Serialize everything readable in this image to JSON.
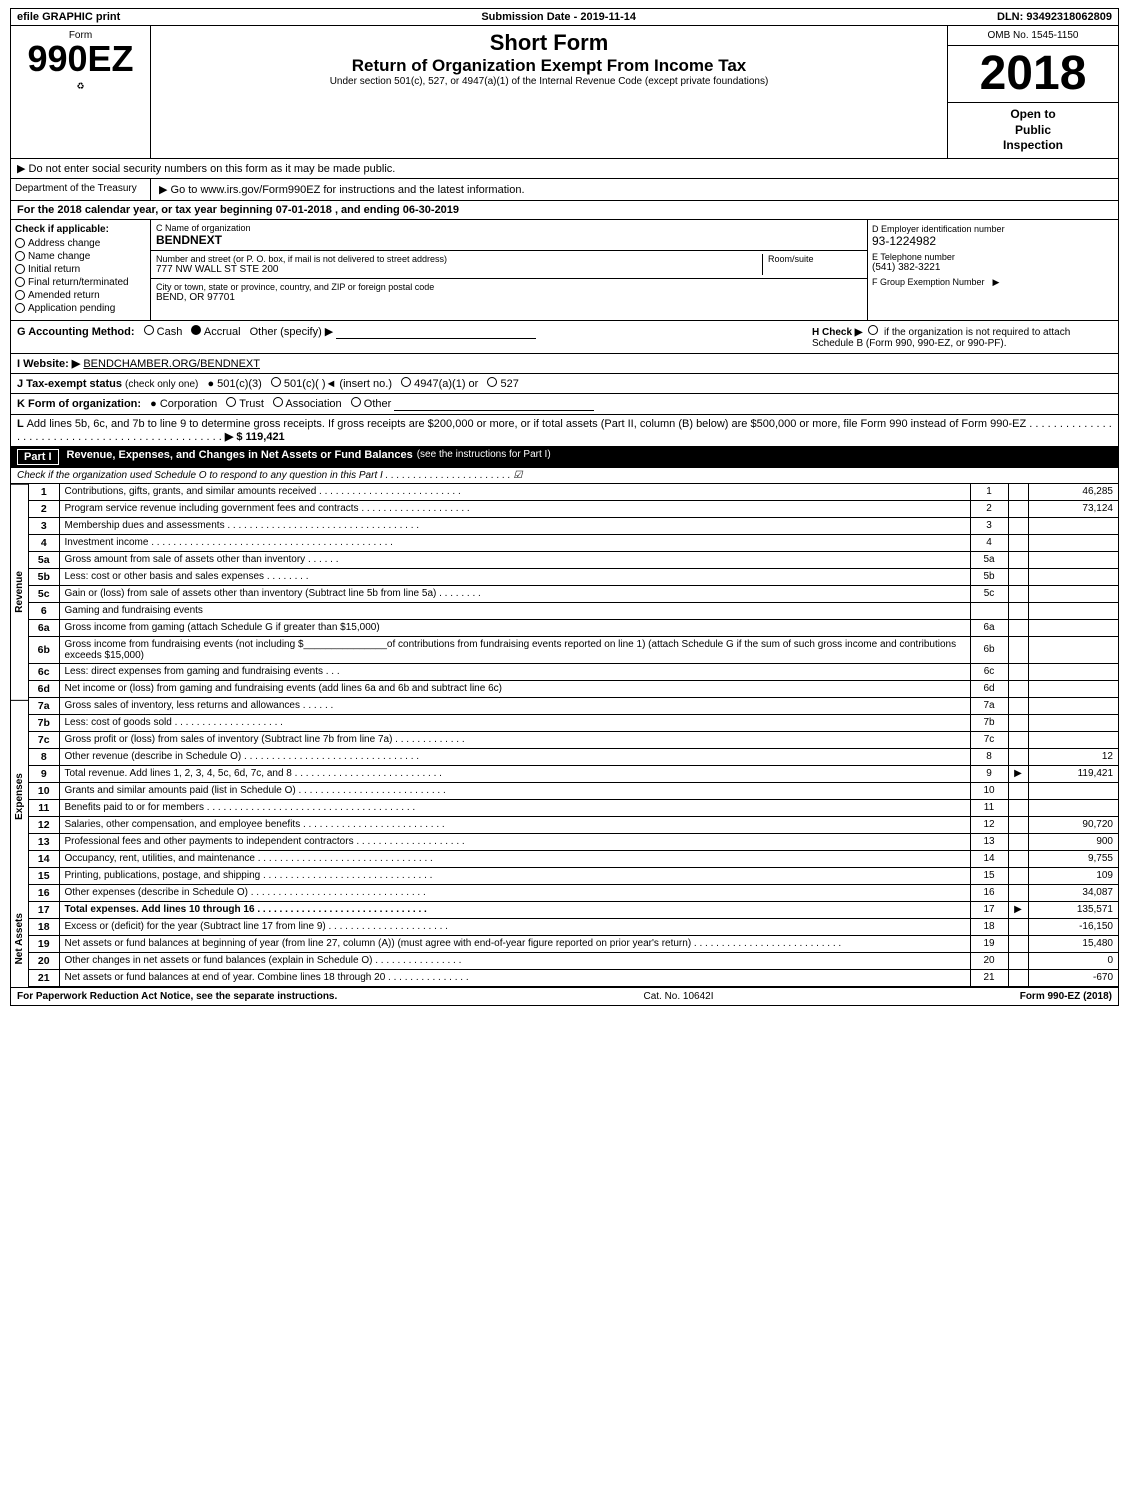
{
  "header": {
    "efile_label": "efile GRAPHIC print",
    "submission_label": "Submission Date - 2019-11-14",
    "dln_label": "DLN: 93492318062809"
  },
  "form_info": {
    "form_number": "990EZ",
    "form_label": "Form",
    "short_form": "Short Form",
    "return_title": "Return of Organization Exempt From Income Tax",
    "under_section": "Under section 501(c), 527, or 4947(a)(1) of the Internal Revenue Code (except private foundations)",
    "omb": "OMB No. 1545-1150",
    "year": "2018",
    "open_to_public": "Open to\nPublic\nInspection"
  },
  "notices": {
    "ssn_notice": "▶ Do not enter social security numbers on this form as it may be made public.",
    "irs_notice": "▶ Go to www.irs.gov/Form990EZ for instructions and the latest information."
  },
  "dept": {
    "name": "Department of the Treasury"
  },
  "tax_year": {
    "text": "For the 2018 calendar year, or tax year beginning 07-01-2018",
    "ending": ", and ending 06-30-2019"
  },
  "check_if": {
    "label": "Check if applicable:",
    "items": [
      {
        "label": "Address change",
        "checked": false
      },
      {
        "label": "Name change",
        "checked": false
      },
      {
        "label": "Initial return",
        "checked": false
      },
      {
        "label": "Final return/terminated",
        "checked": false
      },
      {
        "label": "Amended return",
        "checked": false
      },
      {
        "label": "Application pending",
        "checked": false
      }
    ]
  },
  "org": {
    "c_label": "C Name of organization",
    "name": "BENDNEXT",
    "street_label": "Number and street (or P. O. box, if mail is not delivered to street address)",
    "street": "777 NW WALL ST STE 200",
    "room_label": "Room/suite",
    "room": "",
    "city_label": "City or town, state or province, country, and ZIP or foreign postal code",
    "city": "BEND, OR  97701",
    "d_label": "D Employer identification number",
    "ein": "93-1224982",
    "e_label": "E Telephone number",
    "phone": "(541) 382-3221",
    "f_label": "F Group Exemption Number",
    "group_num": ""
  },
  "accounting": {
    "g_label": "G Accounting Method:",
    "cash": "Cash",
    "accrual": "Accrual",
    "accrual_checked": true,
    "other": "Other (specify) ▶",
    "h_label": "H  Check ▶",
    "h_text": "if the organization is not required to attach Schedule B (Form 990, 990-EZ, or 990-PF)."
  },
  "website": {
    "i_label": "I Website: ▶",
    "url": "BENDCHAMBER.ORG/BENDNEXT"
  },
  "tax_exempt": {
    "j_label": "J Tax-exempt status",
    "j_note": "(check only one)",
    "options": [
      "501(c)(3)",
      "501(c)(  )◄ (insert no.)",
      "4947(a)(1) or",
      "527"
    ],
    "checked": "501(c)(3)"
  },
  "form_org": {
    "k_label": "K Form of organization:",
    "options": [
      "Corporation",
      "Trust",
      "Association",
      "Other"
    ],
    "checked": "Corporation"
  },
  "l_section": {
    "text": "L Add lines 5b, 6c, and 7b to line 9 to determine gross receipts. If gross receipts are $200,000 or more, or if total assets (Part II, column (B) below) are $500,000 or more, file Form 990 instead of Form 990-EZ . . . . . . . . . . . . . . . . . . . . . . . . . . . . . . . . . . .",
    "amount": "▶ $ 119,421"
  },
  "part1": {
    "label": "Part I",
    "title": "Revenue, Expenses, and Changes in Net Assets or Fund Balances",
    "see_instructions": "(see the instructions for Part I)",
    "schedule_check": "Check if the organization used Schedule O to respond to any question in this Part I . . . . . . . . . . . . . . . . . . . . . . .",
    "schedule_check_box": "☑"
  },
  "revenue_label": "Revenue",
  "expenses_label": "Expenses",
  "net_assets_label": "Net Assets",
  "lines": [
    {
      "num": "1",
      "desc": "Contributions, gifts, grants, and similar amounts received . . . . . . . . . . . . . . . . . . . . . . . . . .",
      "box": "1",
      "val": "46,285"
    },
    {
      "num": "2",
      "desc": "Program service revenue including government fees and contracts . . . . . . . . . . . . . . . . . . . .",
      "box": "2",
      "val": "73,124"
    },
    {
      "num": "3",
      "desc": "Membership dues and assessments . . . . . . . . . . . . . . . . . . . . . . . . . . . . . . . . . . .",
      "box": "3",
      "val": ""
    },
    {
      "num": "4",
      "desc": "Investment income . . . . . . . . . . . . . . . . . . . . . . . . . . . . . . . . . . . . . . . . . . . .",
      "box": "4",
      "val": ""
    },
    {
      "num": "5a",
      "desc": "Gross amount from sale of assets other than inventory . . . . . .",
      "box": "5a",
      "val": ""
    },
    {
      "num": "5b",
      "desc": "Less: cost or other basis and sales expenses . . . . . . . .",
      "box": "5b",
      "val": ""
    },
    {
      "num": "5c",
      "desc": "Gain or (loss) from sale of assets other than inventory (Subtract line 5b from line 5a) . . . . . . . .",
      "box": "5c",
      "val": ""
    },
    {
      "num": "6",
      "desc": "Gaming and fundraising events",
      "box": "",
      "val": ""
    },
    {
      "num": "6a",
      "desc": "Gross income from gaming (attach Schedule G if greater than $15,000)",
      "box": "6a",
      "val": ""
    },
    {
      "num": "6b",
      "desc": "Gross income from fundraising events (not including $_______________of contributions from fundraising events reported on line 1) (attach Schedule G if the sum of such gross income and contributions exceeds $15,000)",
      "box": "6b",
      "val": ""
    },
    {
      "num": "6c",
      "desc": "Less: direct expenses from gaming and fundraising events  .  .  .",
      "box": "6c",
      "val": ""
    },
    {
      "num": "6d",
      "desc": "Net income or (loss) from gaming and fundraising events (add lines 6a and 6b and subtract line 6c)",
      "box": "6d",
      "val": ""
    },
    {
      "num": "7a",
      "desc": "Gross sales of inventory, less returns and allowances . . . . . .",
      "box": "7a",
      "val": ""
    },
    {
      "num": "7b",
      "desc": "Less: cost of goods sold   .  .  .  .  .  .  .  .  .  .  .  .  .  .  .  .  .  .  .  .",
      "box": "7b",
      "val": ""
    },
    {
      "num": "7c",
      "desc": "Gross profit or (loss) from sales of inventory (Subtract line 7b from line 7a) . . . . . . . . . . . . .",
      "box": "7c",
      "val": ""
    },
    {
      "num": "8",
      "desc": "Other revenue (describe in Schedule O) . . . . . . . . . . . . . . . . . . . . . . . . . . . . . . . .",
      "box": "8",
      "val": "12"
    },
    {
      "num": "9",
      "desc": "Total revenue. Add lines 1, 2, 3, 4, 5c, 6d, 7c, and 8 . . . . . . . . . . . . . . . . . . . . . . . . . . .",
      "box": "9",
      "val": "119,421",
      "arrow": "▶"
    },
    {
      "num": "10",
      "desc": "Grants and similar amounts paid (list in Schedule O) . . . . . . . . . . . . . . . . . . . . . . . . . . .",
      "box": "10",
      "val": ""
    },
    {
      "num": "11",
      "desc": "Benefits paid to or for members . . . . . . . . . . . . . . . . . . . . . . . . . . . . . . . . . . . . . .",
      "box": "11",
      "val": ""
    },
    {
      "num": "12",
      "desc": "Salaries, other compensation, and employee benefits . . . . . . . . . . . . . . . . . . . . . . . . . .",
      "box": "12",
      "val": "90,720"
    },
    {
      "num": "13",
      "desc": "Professional fees and other payments to independent contractors . . . . . . . . . . . . . . . . . . . .",
      "box": "13",
      "val": "900"
    },
    {
      "num": "14",
      "desc": "Occupancy, rent, utilities, and maintenance . . . . . . . . . . . . . . . . . . . . . . . . . . . . . . . .",
      "box": "14",
      "val": "9,755"
    },
    {
      "num": "15",
      "desc": "Printing, publications, postage, and shipping . . . . . . . . . . . . . . . . . . . . . . . . . . . . . . .",
      "box": "15",
      "val": "109"
    },
    {
      "num": "16",
      "desc": "Other expenses (describe in Schedule O) . . . . . . . . . . . . . . . . . . . . . . . . . . . . . . . .",
      "box": "16",
      "val": "34,087"
    },
    {
      "num": "17",
      "desc": "Total expenses. Add lines 10 through 16 . . . . . . . . . . . . . . . . . . . . . . . . . . . . . . .",
      "box": "17",
      "val": "135,571",
      "arrow": "▶",
      "bold": true
    },
    {
      "num": "18",
      "desc": "Excess or (deficit) for the year (Subtract line 17 from line 9) . . . . . . . . . . . . . . . . . . . . . .",
      "box": "18",
      "val": "-16,150"
    },
    {
      "num": "19",
      "desc": "Net assets or fund balances at beginning of year (from line 27, column (A)) (must agree with end-of-year figure reported on prior year's return)   . . . . . . . . . . . . . . . . . . . . . . . . . . .",
      "box": "19",
      "val": "15,480"
    },
    {
      "num": "20",
      "desc": "Other changes in net assets or fund balances (explain in Schedule O) . . . . . . . . . . . . . . . .",
      "box": "20",
      "val": "0"
    },
    {
      "num": "21",
      "desc": "Net assets or fund balances at end of year. Combine lines 18 through 20 . . . . . . . . . . . . . . .",
      "box": "21",
      "val": "-670"
    }
  ],
  "footer": {
    "left": "For Paperwork Reduction Act Notice, see the separate instructions.",
    "cat": "Cat. No. 10642I",
    "right": "Form 990-EZ (2018)"
  }
}
